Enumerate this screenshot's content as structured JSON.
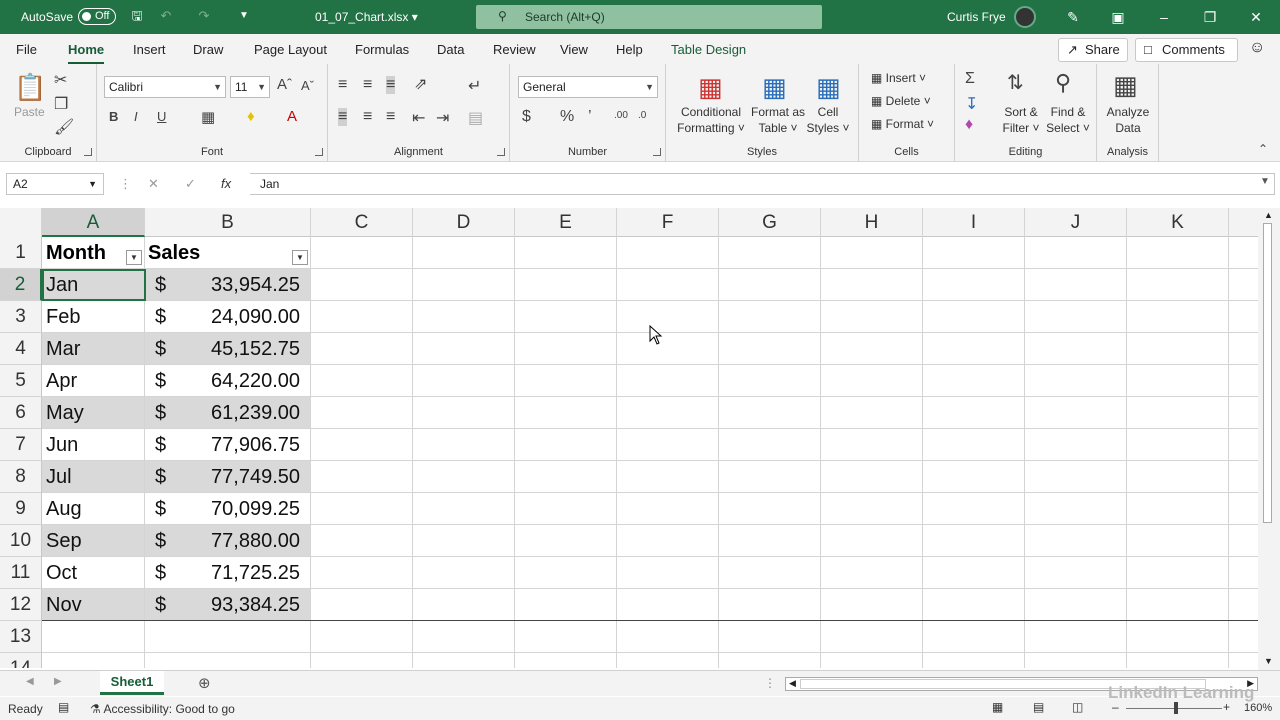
{
  "titlebar": {
    "autosave_label": "AutoSave",
    "autosave_state": "Off",
    "filename": "01_07_Chart.xlsx",
    "search_placeholder": "Search (Alt+Q)",
    "user": "Curtis Frye"
  },
  "tabs": [
    "File",
    "Home",
    "Insert",
    "Draw",
    "Page Layout",
    "Formulas",
    "Data",
    "Review",
    "View",
    "Help",
    "Table Design"
  ],
  "share_label": "Share",
  "comments_label": "Comments",
  "ribbon": {
    "clipboard": {
      "paste": "Paste",
      "label": "Clipboard"
    },
    "font": {
      "name": "Calibri",
      "size": "11",
      "label": "Font"
    },
    "alignment": {
      "label": "Alignment"
    },
    "number": {
      "format": "General",
      "label": "Number"
    },
    "styles": {
      "cond1": "Conditional",
      "cond2": "Formatting",
      "fmt1": "Format as",
      "fmt2": "Table",
      "cell1": "Cell",
      "cell2": "Styles",
      "label": "Styles"
    },
    "cells": {
      "insert": "Insert",
      "delete": "Delete",
      "format": "Format",
      "label": "Cells"
    },
    "editing": {
      "sort1": "Sort &",
      "sort2": "Filter",
      "find1": "Find &",
      "find2": "Select",
      "label": "Editing"
    },
    "analysis": {
      "a1": "Analyze",
      "a2": "Data",
      "label": "Analysis"
    }
  },
  "formula_bar": {
    "name_box": "A2",
    "fx": "fx",
    "value": "Jan"
  },
  "columns": [
    "A",
    "B",
    "C",
    "D",
    "E",
    "F",
    "G",
    "H",
    "I",
    "J",
    "K"
  ],
  "rows": [
    "1",
    "2",
    "3",
    "4",
    "5",
    "6",
    "7",
    "8",
    "9",
    "10",
    "11",
    "12",
    "13",
    "14"
  ],
  "table": {
    "headers": {
      "month": "Month",
      "sales": "Sales"
    },
    "currency": "$",
    "data": [
      {
        "month": "Jan",
        "sales": "33,954.25"
      },
      {
        "month": "Feb",
        "sales": "24,090.00"
      },
      {
        "month": "Mar",
        "sales": "45,152.75"
      },
      {
        "month": "Apr",
        "sales": "64,220.00"
      },
      {
        "month": "May",
        "sales": "61,239.00"
      },
      {
        "month": "Jun",
        "sales": "77,906.75"
      },
      {
        "month": "Jul",
        "sales": "77,749.50"
      },
      {
        "month": "Aug",
        "sales": "70,099.25"
      },
      {
        "month": "Sep",
        "sales": "77,880.00"
      },
      {
        "month": "Oct",
        "sales": "71,725.25"
      },
      {
        "month": "Nov",
        "sales": "93,384.25"
      }
    ]
  },
  "sheet_tab": "Sheet1",
  "status": {
    "ready": "Ready",
    "accessibility": "Accessibility: Good to go",
    "zoom": "160%",
    "watermark": "LinkedIn Learning"
  }
}
